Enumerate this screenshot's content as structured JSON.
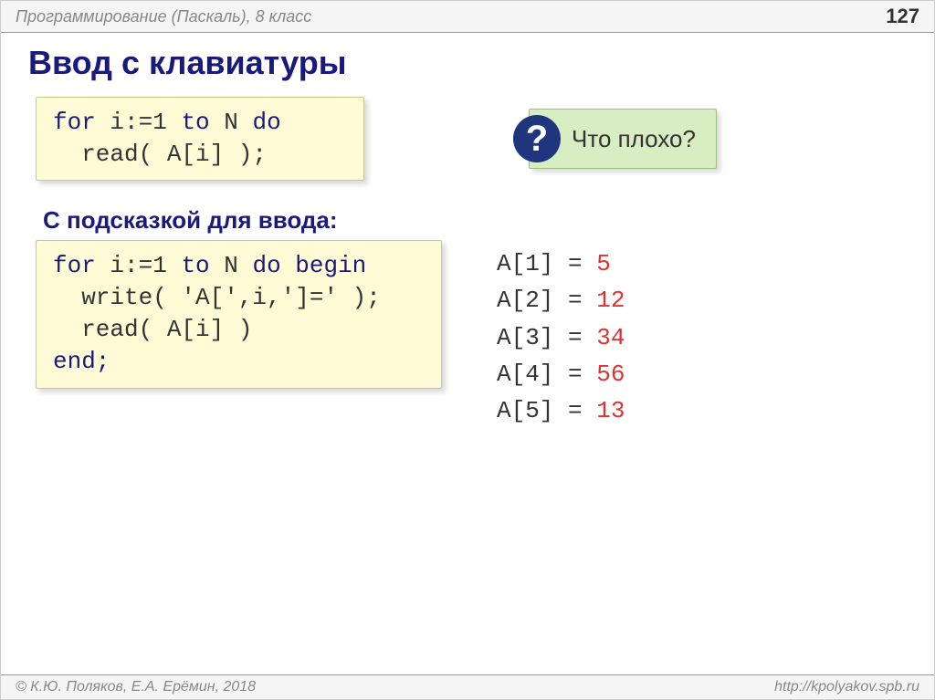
{
  "header": {
    "subject": "Программирование (Паскаль), 8 класс",
    "page_number": "127"
  },
  "title": "Ввод с клавиатуры",
  "code_block_1": {
    "line1_a": "for",
    "line1_b": " i:=1 ",
    "line1_c": "to",
    "line1_d": " N ",
    "line1_e": "do",
    "line2": "  read( A[i] );"
  },
  "question": {
    "mark": "?",
    "text": "Что плохо?"
  },
  "subtitle": "С подсказкой для ввода:",
  "code_block_2": {
    "l1a": "for",
    "l1b": " i:=1 ",
    "l1c": "to",
    "l1d": " N ",
    "l1e": "do begin",
    "l2": "  write( 'A[',i,']=' );",
    "l3": "  read( A[i] )",
    "l4": "end;"
  },
  "output": [
    {
      "label": "A[1] =",
      "value": "5"
    },
    {
      "label": "A[2] =",
      "value": "12"
    },
    {
      "label": "A[3] =",
      "value": "34"
    },
    {
      "label": "A[4] =",
      "value": "56"
    },
    {
      "label": "A[5] =",
      "value": "13"
    }
  ],
  "footer": {
    "authors": "© К.Ю. Поляков, Е.А. Ерёмин, 2018",
    "url": "http://kpolyakov.spb.ru"
  }
}
